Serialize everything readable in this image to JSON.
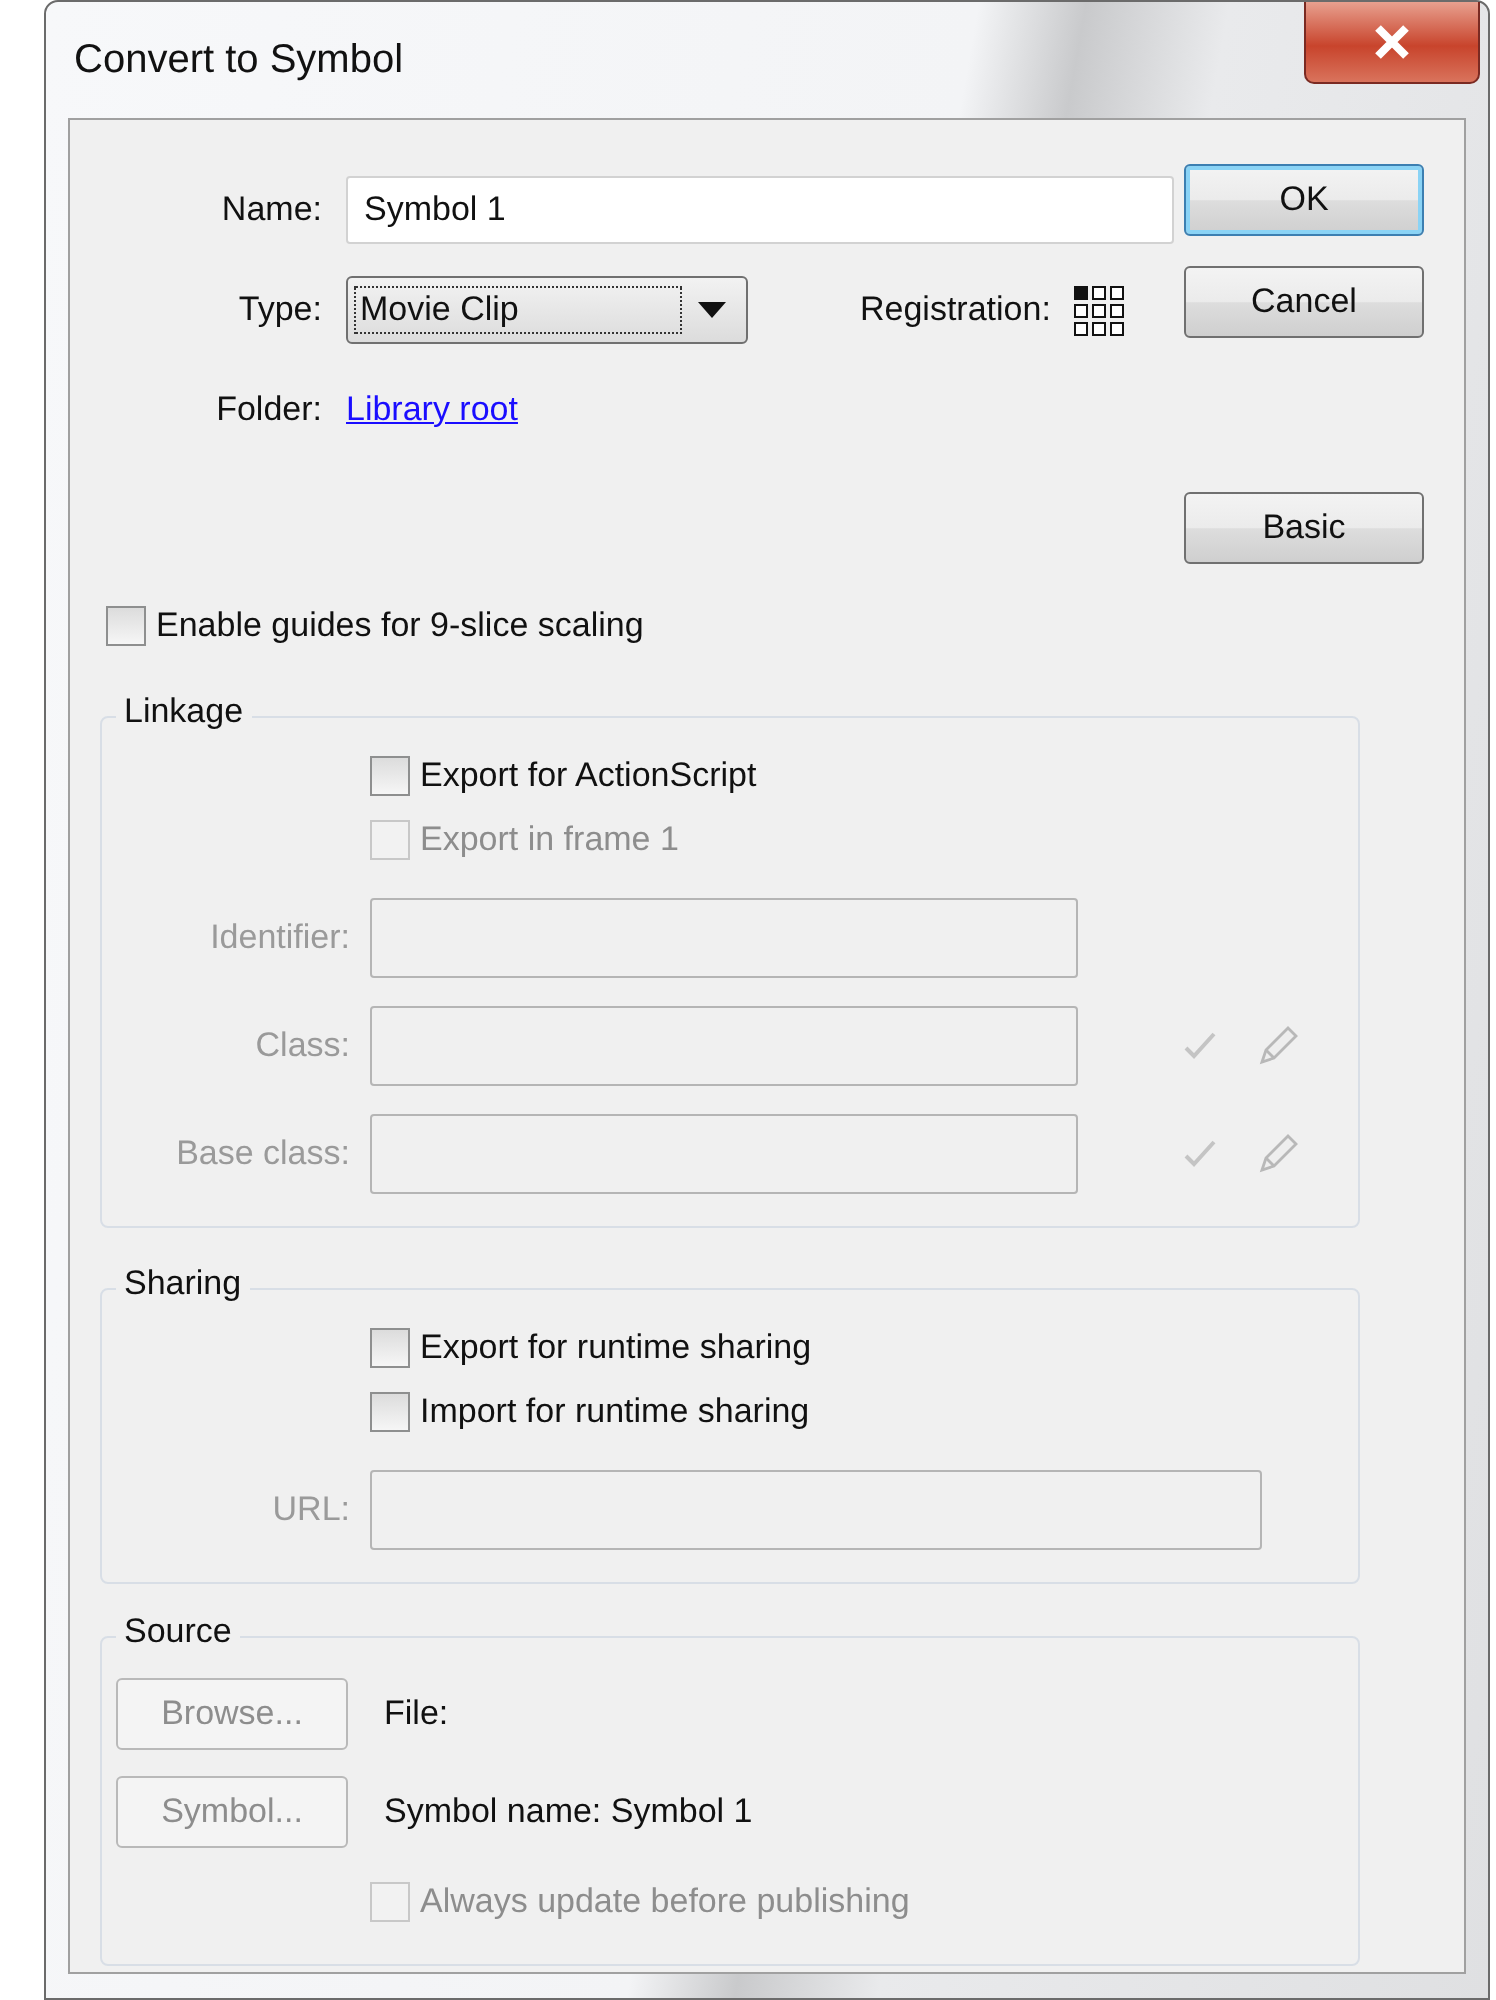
{
  "window": {
    "title": "Convert to Symbol"
  },
  "name_field": {
    "label": "Name:",
    "value": "Symbol 1"
  },
  "type_field": {
    "label": "Type:",
    "value": "Movie Clip"
  },
  "registration": {
    "label": "Registration:",
    "points": [
      {
        "selected": true
      },
      {
        "selected": false
      },
      {
        "selected": false
      },
      {
        "selected": false
      },
      {
        "selected": false
      },
      {
        "selected": false
      },
      {
        "selected": false
      },
      {
        "selected": false
      },
      {
        "selected": false
      }
    ]
  },
  "folder": {
    "label": "Folder:",
    "link": "Library root"
  },
  "buttons": [
    {
      "label": "OK",
      "default": true
    },
    {
      "label": "Cancel",
      "default": false
    },
    {
      "label": "Basic",
      "default": false
    }
  ],
  "nine_slice": {
    "label": "Enable guides for 9-slice scaling",
    "checked": false,
    "disabled": false
  },
  "linkage": {
    "title": "Linkage",
    "checks": [
      {
        "label": "Export for ActionScript",
        "checked": false,
        "disabled": false
      },
      {
        "label": "Export in frame 1",
        "checked": false,
        "disabled": true
      }
    ],
    "fields": [
      {
        "label": "Identifier:",
        "disabled": true,
        "tools": false
      },
      {
        "label": "Class:",
        "disabled": true,
        "tools": true
      },
      {
        "label": "Base class:",
        "disabled": true,
        "tools": true
      }
    ]
  },
  "sharing": {
    "title": "Sharing",
    "checks": [
      {
        "label": "Export for runtime sharing",
        "checked": false,
        "disabled": false
      },
      {
        "label": "Import for runtime sharing",
        "checked": false,
        "disabled": false
      }
    ],
    "fields": [
      {
        "label": "URL:",
        "disabled": true,
        "tools": false
      }
    ]
  },
  "source": {
    "title": "Source",
    "rows": [
      {
        "button": "Browse...",
        "disabled": true,
        "text": "File:"
      },
      {
        "button": "Symbol...",
        "disabled": true,
        "text": "Symbol name: Symbol 1"
      }
    ],
    "check": {
      "label": "Always update before publishing",
      "checked": false,
      "disabled": true
    }
  }
}
